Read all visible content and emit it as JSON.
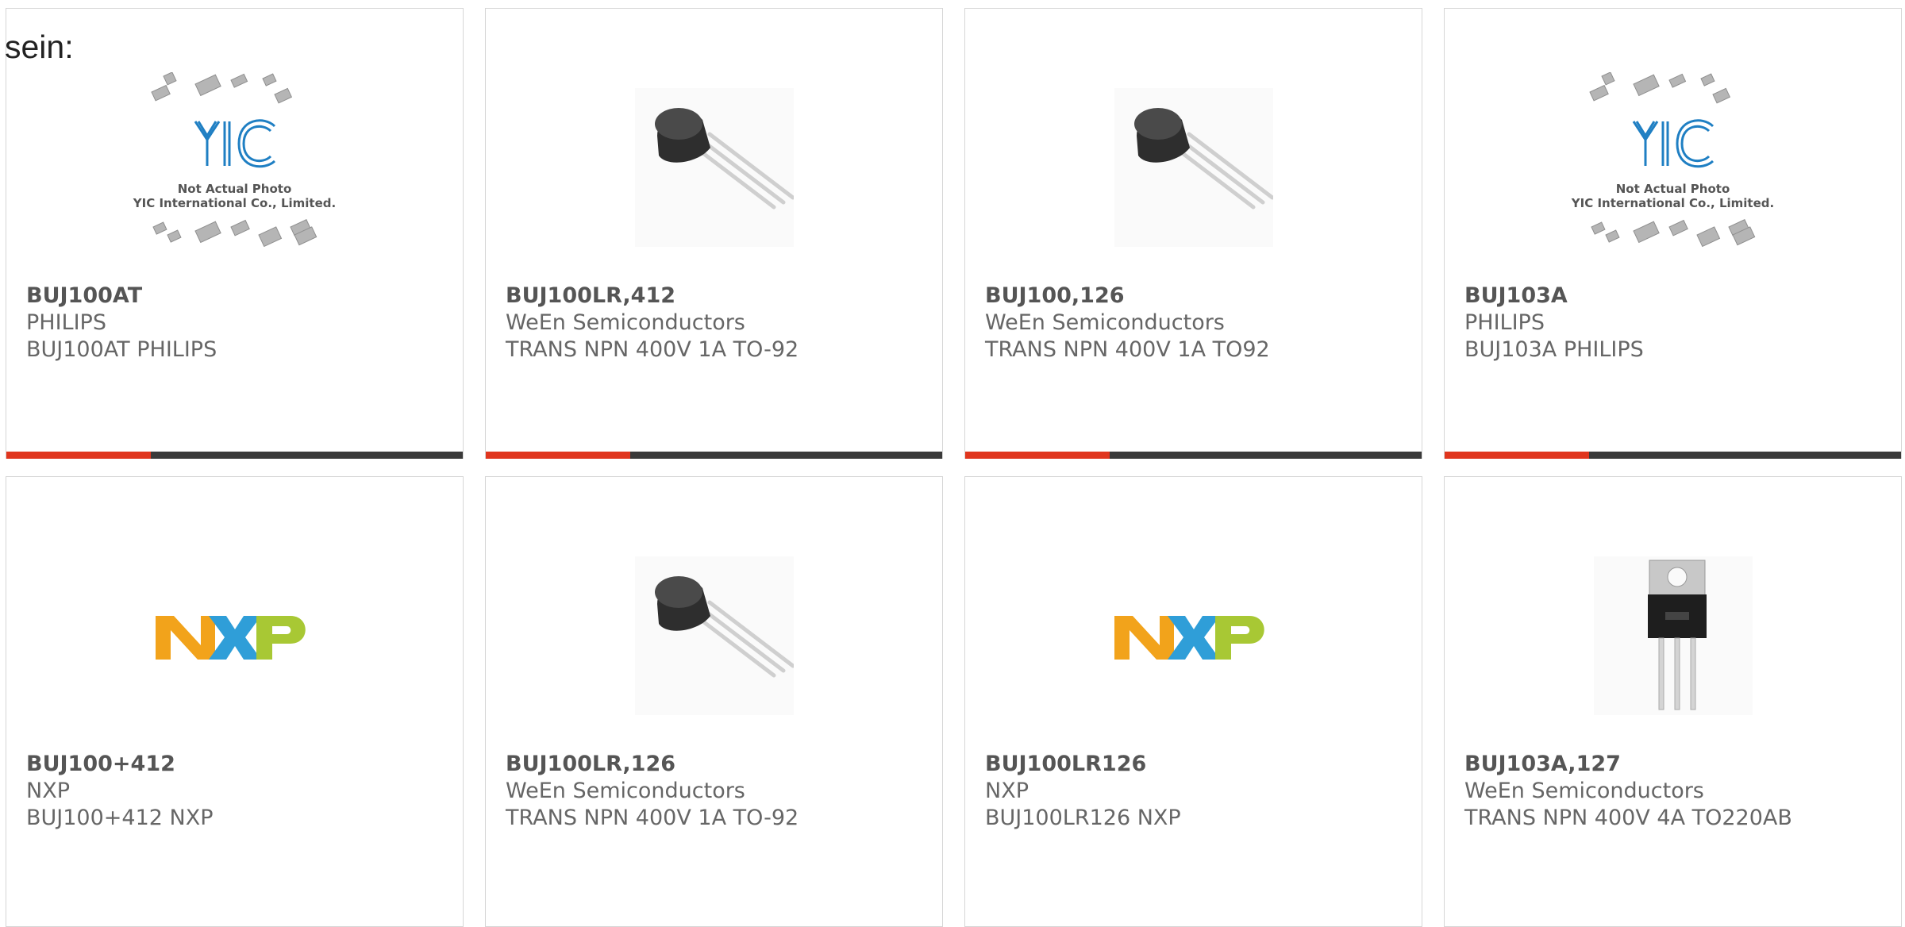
{
  "intro_text": "sein:",
  "colors": {
    "accent_bar": "#e0361e",
    "bar_dark": "#3a3a3a",
    "nxp_orange": "#f2a31b",
    "nxp_blue": "#2f9ed8",
    "nxp_green": "#a8c834",
    "yic_blue": "#1f7fc3"
  },
  "yic_placeholder": {
    "logo": "YIC",
    "line1": "Not Actual Photo",
    "line2": "YIC International Co., Limited."
  },
  "nxp_logo_text": "NXP",
  "cards": [
    {
      "part": "BUJ100AT",
      "mfr": "PHILIPS",
      "desc": "BUJ100AT PHILIPS",
      "image": "yic-placeholder",
      "has_bar": true
    },
    {
      "part": "BUJ100LR,412",
      "mfr": "WeEn Semiconductors",
      "desc": "TRANS NPN 400V 1A TO-92",
      "image": "to92-photo",
      "has_bar": true
    },
    {
      "part": "BUJ100,126",
      "mfr": "WeEn Semiconductors",
      "desc": "TRANS NPN 400V 1A TO92",
      "image": "to92-photo",
      "has_bar": true
    },
    {
      "part": "BUJ103A",
      "mfr": "PHILIPS",
      "desc": "BUJ103A PHILIPS",
      "image": "yic-placeholder",
      "has_bar": true
    },
    {
      "part": "BUJ100+412",
      "mfr": "NXP",
      "desc": "BUJ100+412 NXP",
      "image": "nxp-logo",
      "has_bar": false
    },
    {
      "part": "BUJ100LR,126",
      "mfr": "WeEn Semiconductors",
      "desc": "TRANS NPN 400V 1A TO-92",
      "image": "to92-photo",
      "has_bar": false
    },
    {
      "part": "BUJ100LR126",
      "mfr": "NXP",
      "desc": "BUJ100LR126 NXP",
      "image": "nxp-logo",
      "has_bar": false
    },
    {
      "part": "BUJ103A,127",
      "mfr": "WeEn Semiconductors",
      "desc": "TRANS NPN 400V 4A TO220AB",
      "image": "to220-photo",
      "has_bar": false
    }
  ]
}
